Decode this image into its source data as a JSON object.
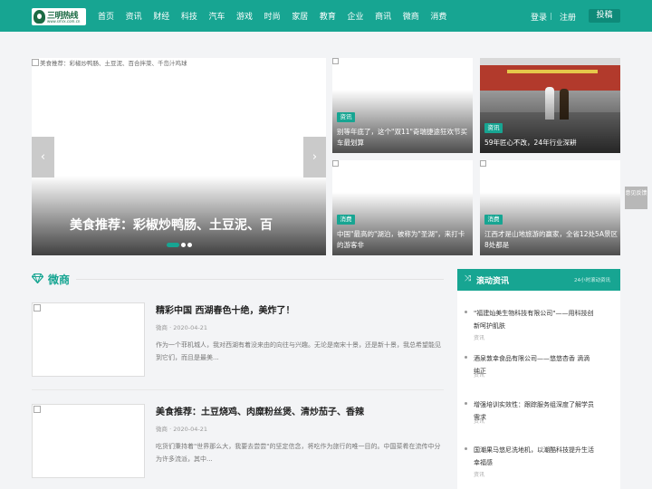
{
  "header": {
    "logo_text": "三明热线",
    "logo_sub": "www.smrx.com.cn",
    "nav": [
      "首页",
      "资讯",
      "财经",
      "科技",
      "汽车",
      "游戏",
      "时尚",
      "家居",
      "教育",
      "企业",
      "商讯",
      "微商",
      "消费"
    ],
    "login": "登录",
    "register": "注册",
    "submit": "投稿"
  },
  "slider": {
    "img_alt": "美食推荐：彩椒炒鸭肠、土豆泥、百合拌菜、千岛汁鸡球",
    "caption": "美食推荐：彩椒炒鸭肠、土豆泥、百",
    "prev": "‹",
    "next": "›",
    "active_slide": 1,
    "slide_count": 3
  },
  "cards": [
    {
      "tag": "资讯",
      "title": "别等年底了，这个\"双11\"奇瑞捷途狂欢节买车最划算"
    },
    {
      "tag": "资讯",
      "title": "59年匠心不改，24年行业深耕"
    },
    {
      "tag": "消费",
      "title": "中国\"最高的\"湖泊，被称为\"圣湖\"，来打卡的游客非"
    },
    {
      "tag": "消费",
      "title": "江西才是山地旅游的赢家，全省12处5A景区8处都是"
    }
  ],
  "section": {
    "title": "微商"
  },
  "articles": [
    {
      "title": "精彩中国 西湖春色十绝，美炸了！",
      "meta": "微商 · 2020-04-21",
      "desc": "作为一个菲机城人，我对西湖有着没来由的向往与兴趣。无论是南宋十景，还是新十景，我总希望能见到它们，而且是最美..."
    },
    {
      "title": "美食推荐：土豆烧鸡、肉糜粉丝煲、清炒茄子、香辣",
      "meta": "微商 · 2020-04-21",
      "desc": "吃货们秉持着\"世界那么大，我要去尝尝\"的坚定信念，将吃作为旅行的唯一目的。中国菜肴在流传中分为许多流派，其中..."
    }
  ],
  "sidebar": {
    "title": "滚动资讯",
    "subtitle": "24小时滚动资讯",
    "source_label": "资讯",
    "items": [
      {
        "title": "\"福建灿美生物科技有限公司\"——用科技创新呵护肌肤"
      },
      {
        "title": "酒泉敦幸食品有限公司——悠悠杏香 滴滴纯正"
      },
      {
        "title": "增强培训实效性：跟踪服务组深度了解学员需求"
      },
      {
        "title": "国潮果马悠尼洗地机，以潮酷科技提升生活幸福感"
      }
    ]
  },
  "float": {
    "label": "意见反馈"
  },
  "colors": {
    "accent": "#17a592"
  }
}
